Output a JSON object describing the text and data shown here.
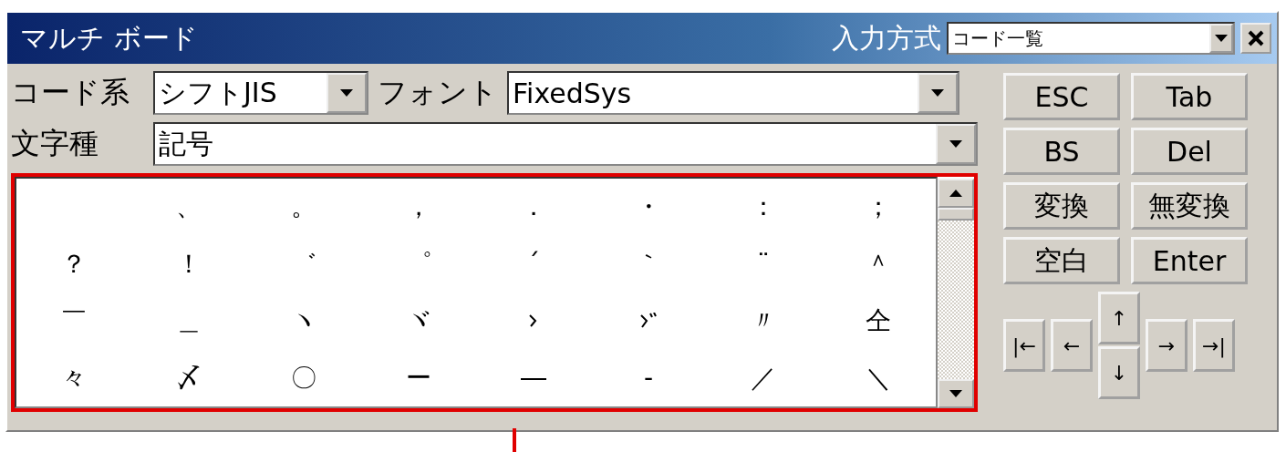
{
  "window": {
    "title": "マルチ ボード"
  },
  "input_method": {
    "label": "入力方式",
    "value": "コード一覧"
  },
  "code_system": {
    "label": "コード系",
    "value": "シフトJIS"
  },
  "font": {
    "label": "フォント",
    "value": "FixedSys"
  },
  "char_type": {
    "label": "文字種",
    "value": "記号"
  },
  "grid": {
    "cells": [
      {
        "kind": "blank"
      },
      {
        "kind": "char",
        "text": "、"
      },
      {
        "kind": "char",
        "text": "。"
      },
      {
        "kind": "char",
        "text": "，"
      },
      {
        "kind": "char",
        "text": "．"
      },
      {
        "kind": "char",
        "text": "・"
      },
      {
        "kind": "char",
        "text": "："
      },
      {
        "kind": "char",
        "text": "；"
      },
      {
        "kind": "char",
        "text": "？"
      },
      {
        "kind": "char",
        "text": "！"
      },
      {
        "kind": "char",
        "text": "゛"
      },
      {
        "kind": "char",
        "text": "゜"
      },
      {
        "kind": "char",
        "text": "´"
      },
      {
        "kind": "char",
        "text": "｀"
      },
      {
        "kind": "char",
        "text": "¨"
      },
      {
        "kind": "char",
        "text": "＾"
      },
      {
        "kind": "char",
        "text": "￣"
      },
      {
        "kind": "char",
        "text": "＿"
      },
      {
        "kind": "char",
        "text": "ヽ"
      },
      {
        "kind": "char",
        "text": "ヾ"
      },
      {
        "kind": "iteration_mark"
      },
      {
        "kind": "voiced_iteration_mark"
      },
      {
        "kind": "char",
        "text": "〃"
      },
      {
        "kind": "char",
        "text": "仝"
      },
      {
        "kind": "char",
        "text": "々"
      },
      {
        "kind": "char",
        "text": "〆"
      },
      {
        "kind": "char",
        "text": "〇"
      },
      {
        "kind": "char",
        "text": "ー"
      },
      {
        "kind": "char",
        "text": "―"
      },
      {
        "kind": "char",
        "text": "‐"
      },
      {
        "kind": "char",
        "text": "／"
      },
      {
        "kind": "char",
        "text": "＼"
      }
    ]
  },
  "keys": [
    "ESC",
    "Tab",
    "BS",
    "Del",
    "変換",
    "無変換",
    "空白",
    "Enter"
  ],
  "nav_keys": [
    "|←",
    "←",
    "↑",
    "↓",
    "→",
    "→|"
  ]
}
